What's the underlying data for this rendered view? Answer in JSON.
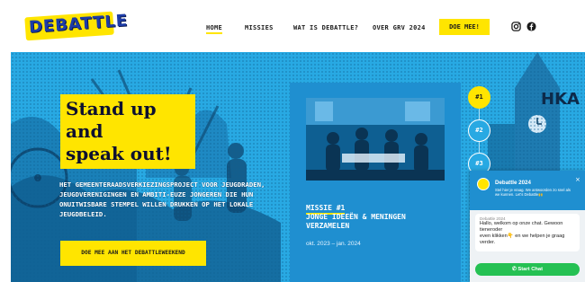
{
  "brand": {
    "logo_text": "DEBATTLE",
    "accent_color": "#ffe500",
    "primary_color": "#28a9e3"
  },
  "nav": {
    "items": [
      {
        "label": "HOME",
        "active": true
      },
      {
        "label": "MISSIES",
        "active": false
      },
      {
        "label": "WAT IS DEBATTLE?",
        "active": false
      },
      {
        "label": "OVER GRV 2024",
        "active": false
      }
    ],
    "cta_label": "DOE MEE!",
    "social_icons": [
      "instagram-icon",
      "facebook-icon"
    ]
  },
  "hero": {
    "headline_line1": "Stand up and",
    "headline_line2": "speak out!",
    "description": "HET GEMEENTERAADSVERKIEZINGSPROJECT VOOR JEUGDRADEN, JEUGDVERENIGINGEN EN AMBITI-EUZE JONGEREN DIE HUN ONUITWISBARE STEMPEL WILLEN DRUKKEN OP HET LOKALE JEUGDBELEID.",
    "cta_label": "DOE MEE AAN HET DEBATTLEWEEKEND"
  },
  "mission": {
    "tag": "MISSIE #1",
    "title": "JONGE IDEEËN & MENINGEN VERZAMELEN",
    "date": "okt. 2023 – jan. 2024"
  },
  "pagination": {
    "items": [
      "#1",
      "#2",
      "#3"
    ],
    "active_index": 0
  },
  "background_sign": "HKA",
  "chat": {
    "title": "Debattle 2024",
    "subtitle_line1": "Stel hier je vraag. We antwoorden zo snel als",
    "subtitle_line2": "we kunnen. Let's Debattle🙌",
    "close_glyph": "×",
    "bubble_name": "Debattle 2024",
    "bubble_line1": "Hallo, welkom op onze chat. Gewoon",
    "bubble_line2": "tieneroder",
    "bubble_line3": "even klikken👇 en we helpen je graag",
    "bubble_line4": "verder.",
    "button_label": "Start Chat",
    "button_color": "#25c153"
  }
}
